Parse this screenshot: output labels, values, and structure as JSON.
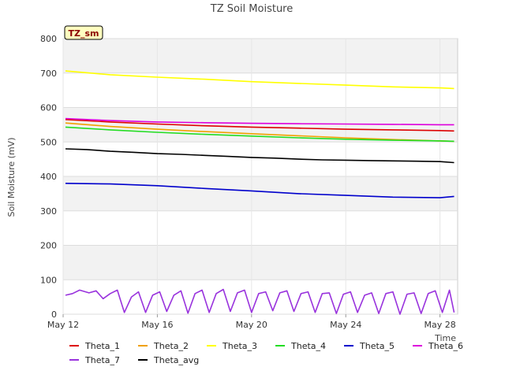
{
  "chart_data": {
    "type": "line",
    "title": "TZ Soil Moisture",
    "xlabel": "Time",
    "ylabel": "Soil Moisture (mV)",
    "badge": "TZ_sm",
    "xlim_days": [
      12,
      28.75
    ],
    "ylim": [
      0,
      800
    ],
    "yticks": [
      0,
      100,
      200,
      300,
      400,
      500,
      600,
      700,
      800
    ],
    "xticks": [
      {
        "day": 12,
        "label": "May 12"
      },
      {
        "day": 16,
        "label": "May 16"
      },
      {
        "day": 20,
        "label": "May 20"
      },
      {
        "day": 24,
        "label": "May 24"
      },
      {
        "day": 28,
        "label": "May 28"
      }
    ],
    "grid": true,
    "legend_position": "bottom",
    "series": [
      {
        "name": "Theta_1",
        "color": "#dd0000",
        "x": [
          12.1,
          14,
          16,
          18,
          20,
          22,
          24,
          26,
          28,
          28.6
        ],
        "y": [
          565,
          558,
          552,
          547,
          543,
          540,
          537,
          535,
          533,
          532
        ]
      },
      {
        "name": "Theta_2",
        "color": "#f0a000",
        "x": [
          12.1,
          14,
          16,
          18,
          20,
          22,
          24,
          26,
          28,
          28.6
        ],
        "y": [
          555,
          545,
          537,
          530,
          524,
          518,
          512,
          507,
          503,
          502
        ]
      },
      {
        "name": "Theta_3",
        "color": "#ffff00",
        "x": [
          12.1,
          14,
          16,
          18,
          20,
          22,
          24,
          26,
          28,
          28.6
        ],
        "y": [
          706,
          695,
          688,
          682,
          675,
          670,
          665,
          660,
          657,
          655
        ]
      },
      {
        "name": "Theta_4",
        "color": "#22dd22",
        "x": [
          12.1,
          14,
          16,
          18,
          20,
          22,
          24,
          26,
          28,
          28.6
        ],
        "y": [
          543,
          535,
          528,
          522,
          517,
          512,
          508,
          505,
          503,
          502
        ]
      },
      {
        "name": "Theta_5",
        "color": "#0000cc",
        "x": [
          12.1,
          14,
          16,
          18,
          20,
          22,
          24,
          26,
          28,
          28.6
        ],
        "y": [
          380,
          378,
          373,
          365,
          358,
          350,
          345,
          340,
          338,
          342
        ]
      },
      {
        "name": "Theta_6",
        "color": "#dd00dd",
        "x": [
          12.1,
          14,
          16,
          18,
          20,
          22,
          24,
          26,
          28,
          28.6
        ],
        "y": [
          568,
          562,
          558,
          556,
          554,
          553,
          552,
          551,
          550,
          550
        ]
      },
      {
        "name": "Theta_7",
        "color": "#9933dd",
        "x": [
          12.1,
          12.4,
          12.7,
          13.1,
          13.4,
          13.7,
          14.0,
          14.3,
          14.6,
          14.9,
          15.2,
          15.5,
          15.8,
          16.1,
          16.4,
          16.7,
          17.0,
          17.3,
          17.6,
          17.9,
          18.2,
          18.5,
          18.8,
          19.1,
          19.4,
          19.7,
          20.0,
          20.3,
          20.6,
          20.9,
          21.2,
          21.5,
          21.8,
          22.1,
          22.4,
          22.7,
          23.0,
          23.3,
          23.6,
          23.9,
          24.2,
          24.5,
          24.8,
          25.1,
          25.4,
          25.7,
          26.0,
          26.3,
          26.6,
          26.9,
          27.2,
          27.5,
          27.8,
          28.1,
          28.4,
          28.6
        ],
        "y": [
          55,
          60,
          70,
          62,
          68,
          45,
          60,
          70,
          5,
          50,
          65,
          5,
          55,
          65,
          8,
          55,
          68,
          3,
          60,
          70,
          5,
          60,
          72,
          8,
          62,
          70,
          5,
          60,
          65,
          10,
          62,
          68,
          8,
          60,
          65,
          5,
          60,
          62,
          2,
          58,
          65,
          5,
          55,
          62,
          2,
          60,
          65,
          0,
          58,
          62,
          2,
          60,
          68,
          5,
          70,
          5
        ]
      },
      {
        "name": "Theta_avg",
        "color": "#000000",
        "x": [
          12.1,
          13,
          14,
          15,
          16,
          17,
          18,
          19,
          20,
          21,
          22,
          23,
          24,
          25,
          26,
          27,
          28,
          28.6
        ],
        "y": [
          480,
          478,
          473,
          470,
          466,
          464,
          461,
          458,
          455,
          453,
          450,
          448,
          447,
          446,
          445,
          444,
          443,
          440
        ]
      }
    ]
  }
}
